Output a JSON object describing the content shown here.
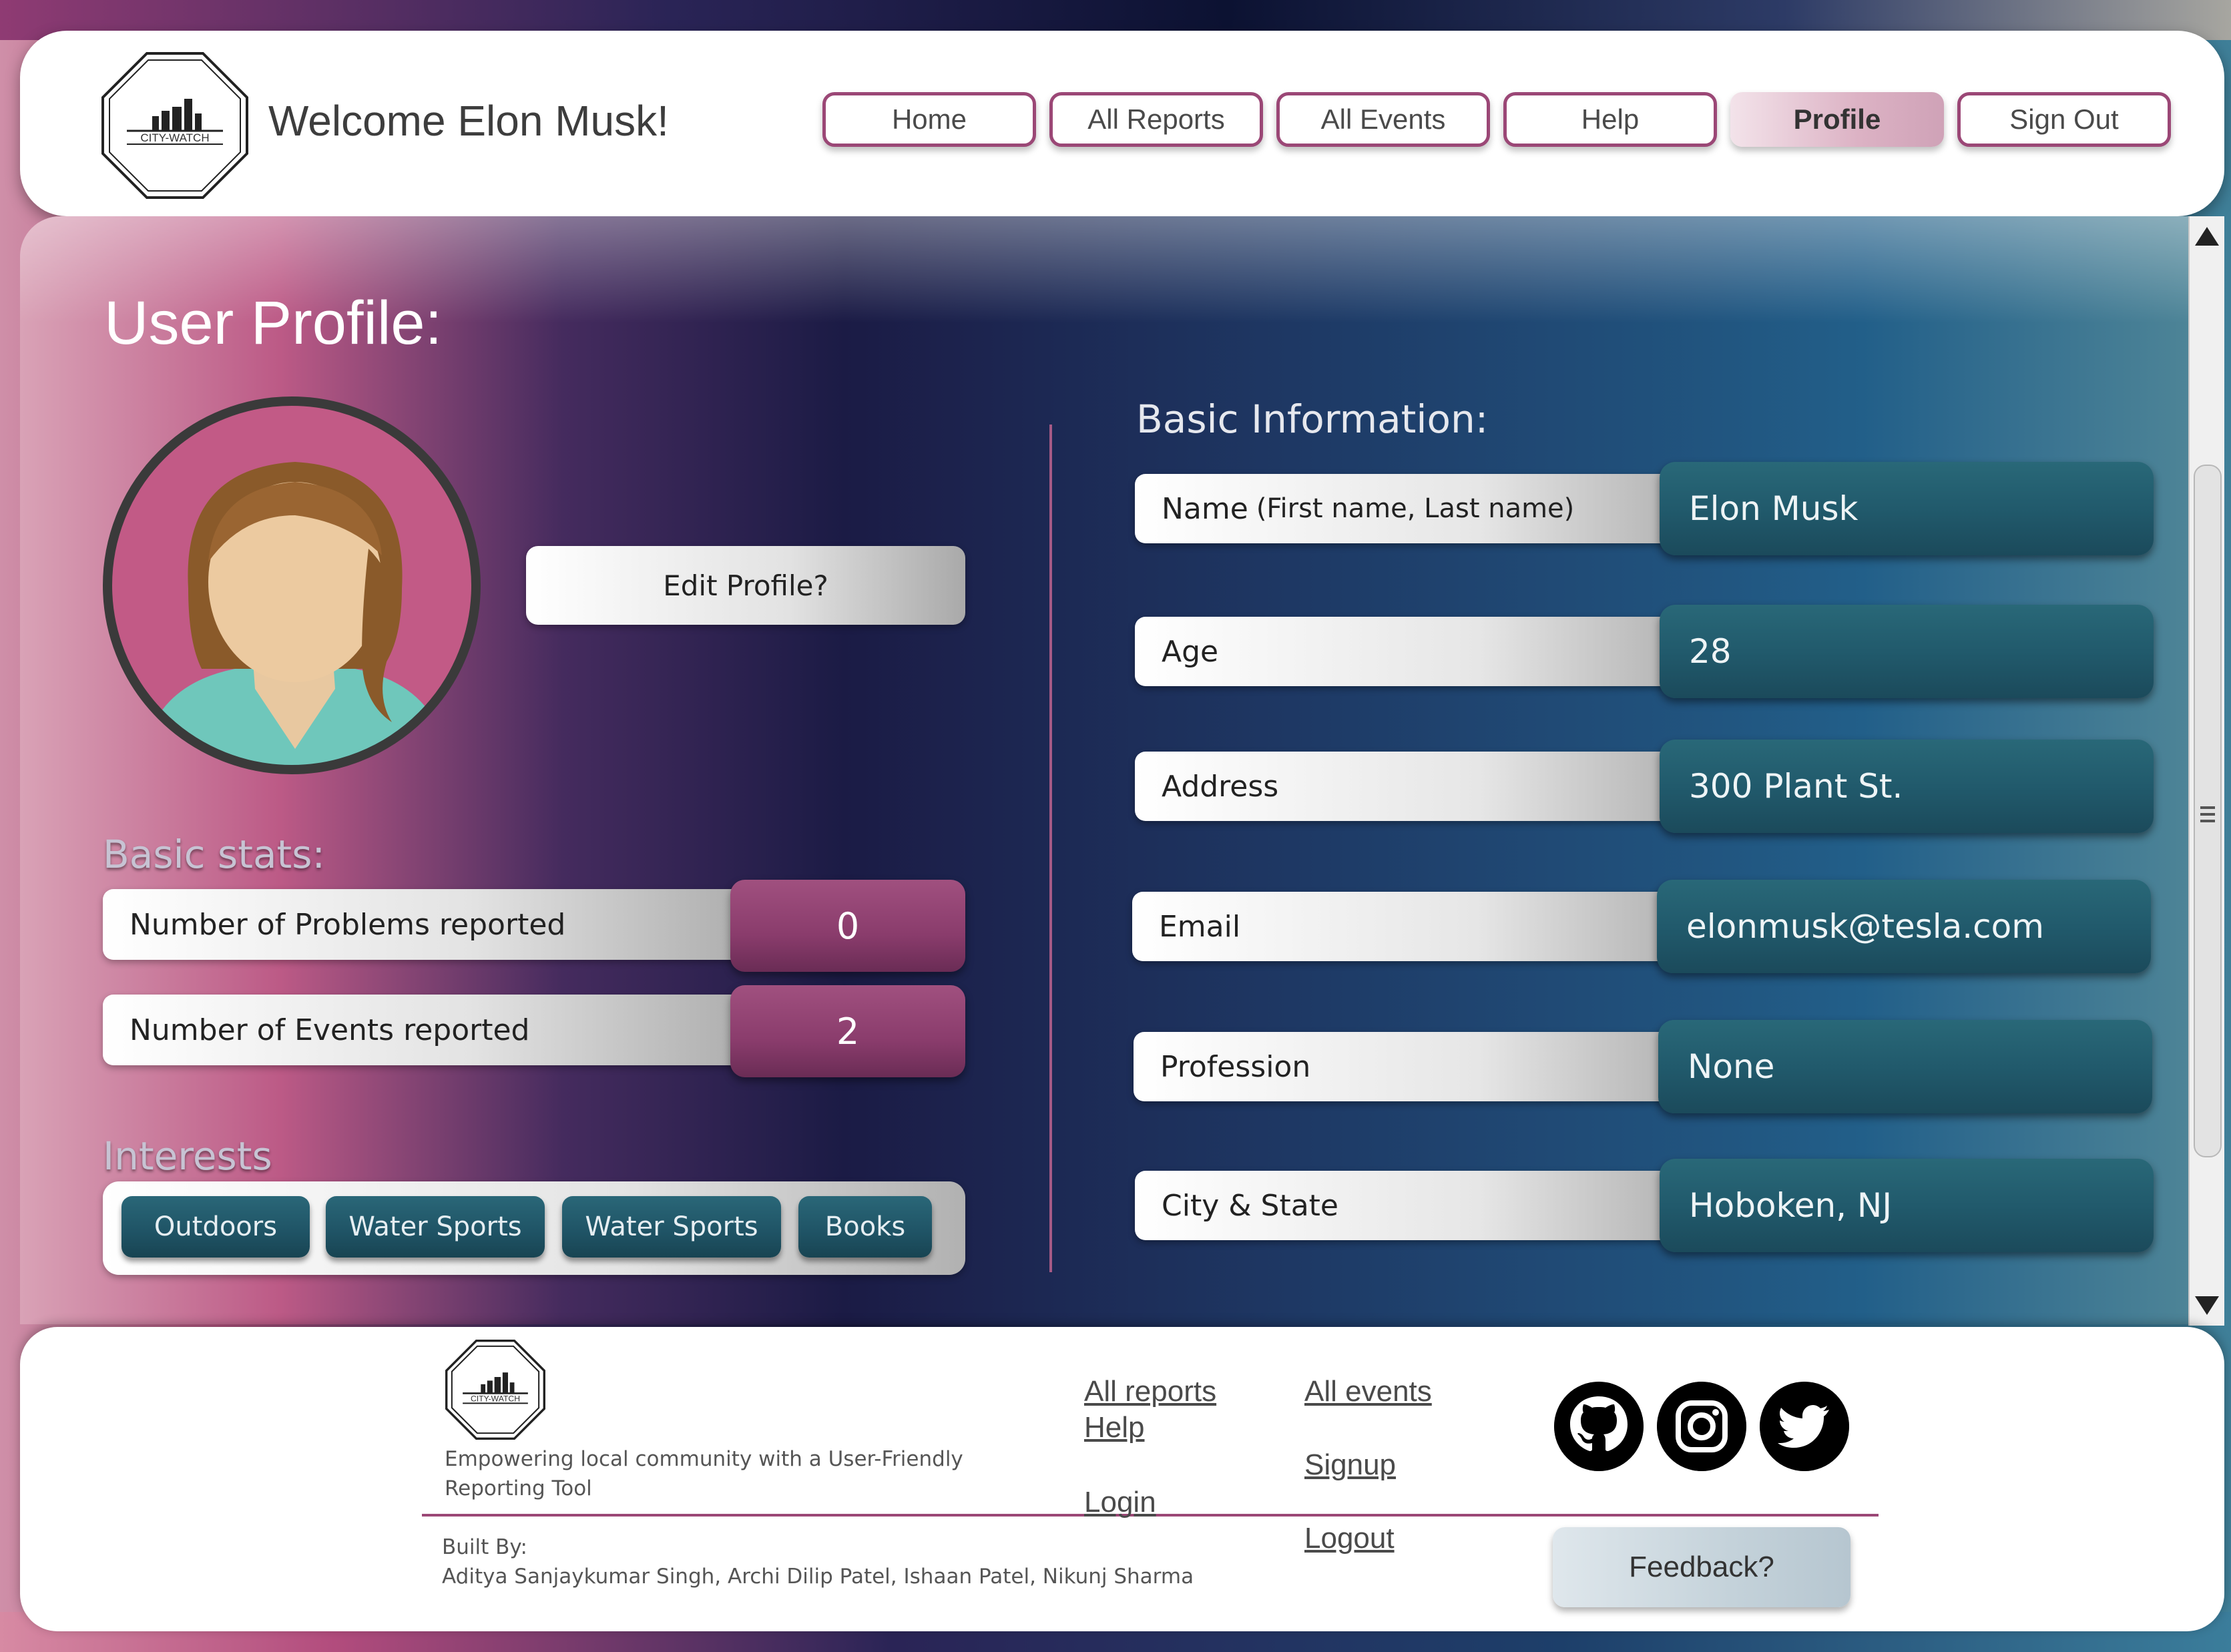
{
  "header": {
    "logo_text": "CITY-WATCH",
    "welcome": "Welcome Elon Musk!",
    "nav": [
      {
        "label": "Home",
        "active": false
      },
      {
        "label": "All Reports",
        "active": false
      },
      {
        "label": "All Events",
        "active": false
      },
      {
        "label": "Help",
        "active": false
      },
      {
        "label": "Profile",
        "active": true
      },
      {
        "label": "Sign Out",
        "active": false
      }
    ]
  },
  "profile": {
    "title": "User Profile:",
    "edit_label": "Edit Profile?",
    "avatar_icon": "user-avatar-icon",
    "stats_title": "Basic stats:",
    "stats": [
      {
        "label": "Number of Problems reported",
        "value": "0"
      },
      {
        "label": "Number of Events reported",
        "value": "2"
      }
    ],
    "interests_title": "Interests",
    "interests": [
      "Outdoors",
      "Water Sports",
      "Water Sports",
      "Books"
    ]
  },
  "basic_info": {
    "title": "Basic Information:",
    "fields": [
      {
        "label": "Name",
        "hint": "(First name, Last name)",
        "value": "Elon Musk"
      },
      {
        "label": "Age",
        "hint": "",
        "value": "28"
      },
      {
        "label": "Address",
        "hint": "",
        "value": "300 Plant St."
      },
      {
        "label": "Email",
        "hint": "",
        "value": "elonmusk@tesla.com"
      },
      {
        "label": "Profession",
        "hint": "",
        "value": "None"
      },
      {
        "label": "City & State",
        "hint": "",
        "value": "Hoboken, NJ"
      }
    ]
  },
  "footer": {
    "logo_text": "CITY-WATCH",
    "tagline": "Empowering local  community with a User-Friendly Reporting Tool",
    "built_by_label": "Built By:",
    "built_by": "Aditya Sanjaykumar Singh, Archi Dilip Patel, Ishaan Patel, Nikunj Sharma",
    "links_col1": [
      "All reports ",
      "Help",
      "Login"
    ],
    "links_col2": [
      "All events",
      "Signup",
      "Logout"
    ],
    "social_icons": [
      "github-icon",
      "instagram-icon",
      "twitter-icon"
    ],
    "feedback_label": "Feedback?"
  },
  "colors": {
    "accent": "#9b4776",
    "stat_value": "#8a3c6c",
    "info_value": "#215a6c",
    "interest_chip": "#1f5365"
  }
}
